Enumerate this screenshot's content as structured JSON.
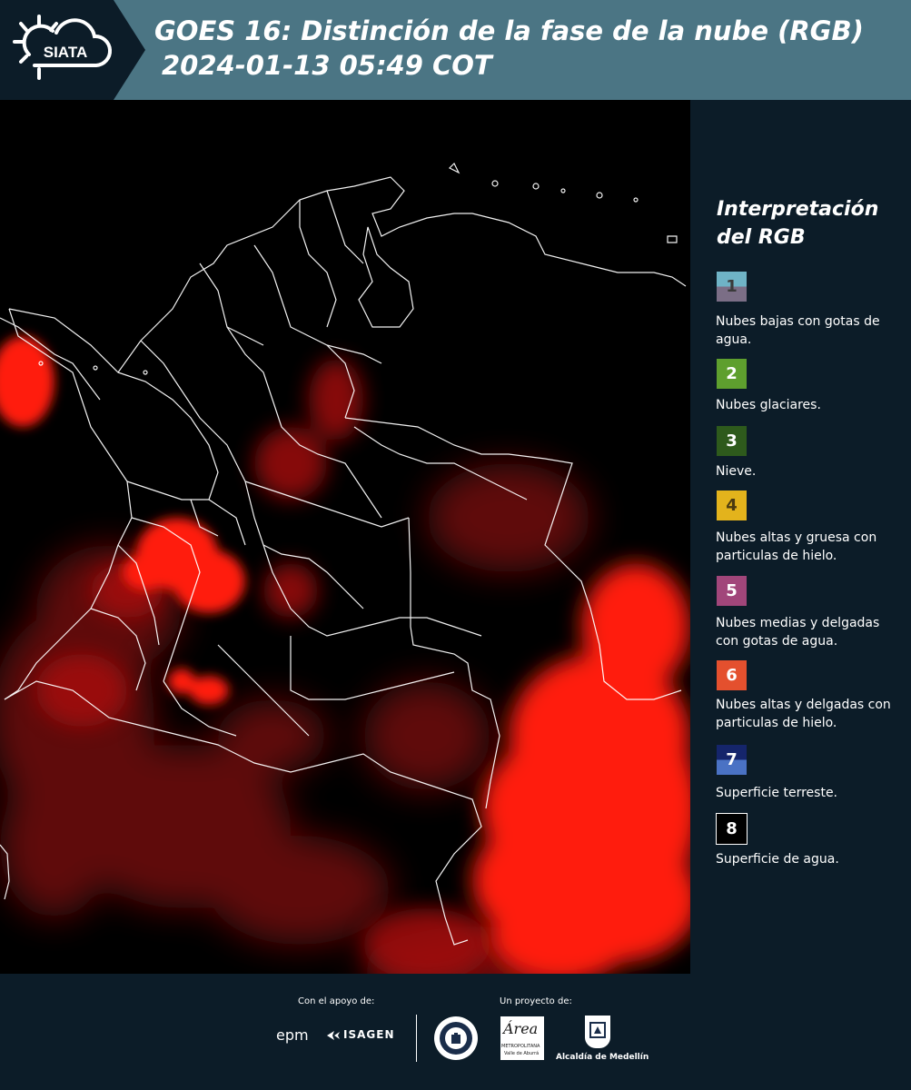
{
  "header": {
    "logo_text": "SIATA",
    "title_line1": "GOES 16: Distinción de la fase de la nube (RGB)",
    "title_line2": "2024-01-13 05:49 COT"
  },
  "legend": {
    "title_line1": "Interpretación",
    "title_line2": "del RGB",
    "items": [
      {
        "number": "1",
        "label": "Nubes bajas con gotas de agua.",
        "color_top": "#6fb3c6",
        "color_bottom": "#7b6e86",
        "text_color": "#3a3a3a"
      },
      {
        "number": "2",
        "label": "Nubes glaciares.",
        "color_top": "#5e9f2e",
        "color_bottom": "#5e9f2e",
        "text_color": "#ffffff"
      },
      {
        "number": "3",
        "label": "Nieve.",
        "color_top": "#2e5a1c",
        "color_bottom": "#2e5a1c",
        "text_color": "#ffffff"
      },
      {
        "number": "4",
        "label": "Nubes altas y gruesa con particulas de hielo.",
        "color_top": "#e3b31c",
        "color_bottom": "#e3b31c",
        "text_color": "#4a3a10"
      },
      {
        "number": "5",
        "label": "Nubes medias y delgadas con gotas de agua.",
        "color_top": "#a1467a",
        "color_bottom": "#a1467a",
        "text_color": "#ffffff"
      },
      {
        "number": "6",
        "label": "Nubes altas y delgadas con particulas de hielo.",
        "color_top": "#e4502e",
        "color_bottom": "#e4502e",
        "text_color": "#ffffff"
      },
      {
        "number": "7",
        "label": "Superficie terreste.",
        "color_top": "#15256b",
        "color_bottom": "#4a72c4",
        "text_color": "#ffffff"
      },
      {
        "number": "8",
        "label": "Superficie de agua.",
        "color_top": "#000000",
        "color_bottom": "#000000",
        "text_color": "#ffffff"
      }
    ]
  },
  "footer": {
    "support_caption": "Con el apoyo de:",
    "project_caption": "Un proyecto de:",
    "sponsor1": "epm",
    "sponsor2": "ISAGEN",
    "partner1": "Área",
    "partner1_sub": "METROPOLITANA",
    "partner1_sub2": "Valle de Aburrá",
    "partner2": "Alcaldía de Medellín"
  },
  "colors": {
    "header_bg": "#4b7584",
    "panel_bg": "#0c1c28",
    "cloud_red": "#ff1a10",
    "boundary": "#ffffff"
  }
}
